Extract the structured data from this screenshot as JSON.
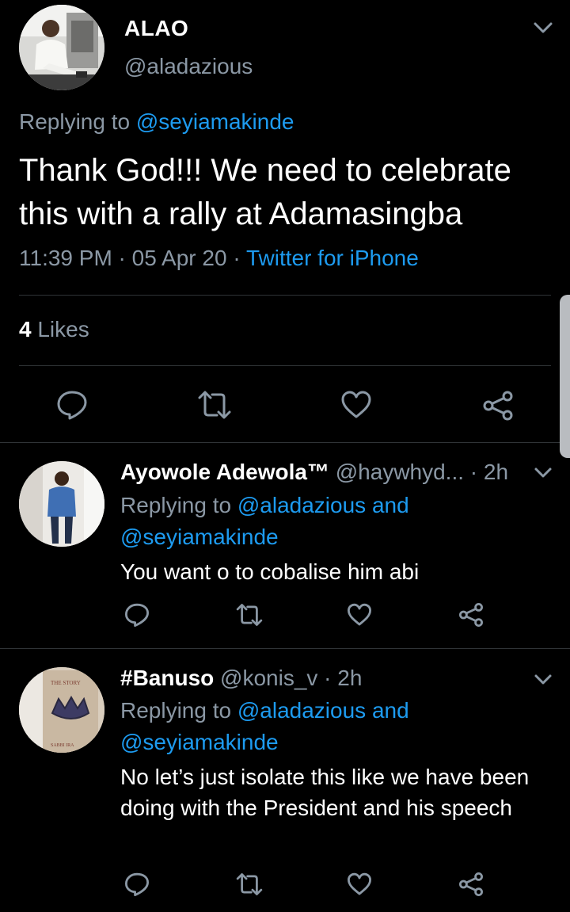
{
  "main_tweet": {
    "name": "ALAO",
    "handle": "@aladazious",
    "replying_prefix": "Replying to ",
    "replying_to": "@seyiamakinde",
    "text_line1": "Thank God!!! We need to celebrate",
    "text_line2": "this with a rally at Adamasingba",
    "time": "11:39 PM",
    "sep": " · ",
    "date": "05 Apr 20",
    "source": "Twitter for iPhone",
    "likes_count": "4",
    "likes_label": " Likes"
  },
  "replies": [
    {
      "name": "Ayowole Adewola™",
      "handle": " @haywhyd...",
      "time": " · 2h",
      "replying_prefix": "Replying to ",
      "replying_to_1": "@aladazious",
      "and": " and",
      "replying_to_2": "@seyiamakinde",
      "text": "You want o to cobalise him abi"
    },
    {
      "name": "#Banuso",
      "handle": " @konis_v",
      "time": " · 2h",
      "replying_prefix": "Replying to ",
      "replying_to_1": "@aladazious",
      "and": " and",
      "replying_to_2": "@seyiamakinde",
      "text": "No let’s just isolate this like we have been doing with the President and his speech"
    }
  ],
  "avatar2_book_text_top": "THE STORY",
  "avatar2_book_text_bottom": "SABBI IRA",
  "icons": [
    "reply-icon",
    "retweet-icon",
    "like-icon",
    "share-icon",
    "chevron-down-icon"
  ],
  "colors": {
    "background": "#000000",
    "text": "#ffffff",
    "secondary": "#8b98a5",
    "link": "#1d9bf0",
    "divider": "#2f3336"
  }
}
